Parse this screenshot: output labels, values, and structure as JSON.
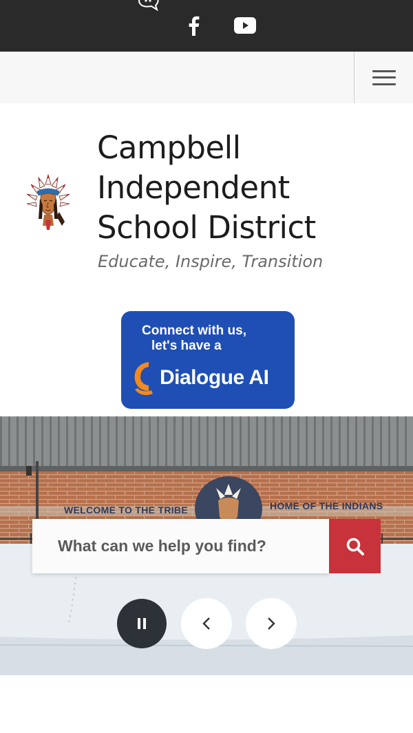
{
  "social": {
    "icons": [
      "chat-icon",
      "facebook-icon",
      "youtube-icon"
    ]
  },
  "nav": {
    "menu_icon": "hamburger-menu-icon"
  },
  "header": {
    "school_name_line1": "Campbell",
    "school_name_line2": "Independent",
    "school_name_line3": "School District",
    "tagline": "Educate, Inspire, Transition"
  },
  "dialogue": {
    "line1": "Connect with us,",
    "line2": "let's have a",
    "brand": "Dialogue AI"
  },
  "hero": {
    "sign_left": "WELCOME TO THE TRIBE",
    "sign_right": "HOME OF THE INDIANS",
    "search_placeholder": "What can we help you find?",
    "controls": [
      "pause-icon",
      "chevron-left-icon",
      "chevron-right-icon"
    ]
  },
  "colors": {
    "top_bar": "#2a2a2a",
    "nav_bar": "#f7f7f7",
    "dialogue_blue": "#1f4fb5",
    "dialogue_orange": "#f28a1e",
    "search_red": "#c8323a",
    "pause_dark": "#2d3138"
  }
}
